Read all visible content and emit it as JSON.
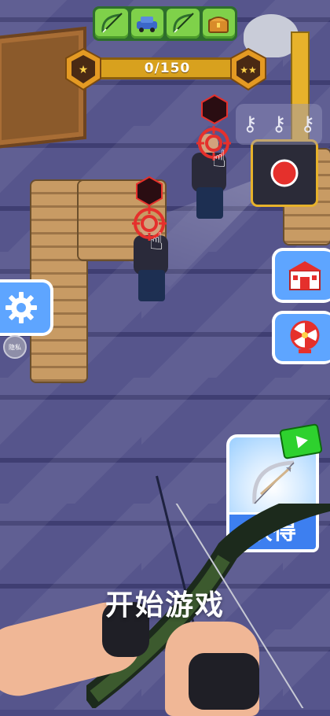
{
  "top_bar": {
    "rewards": [
      {
        "icon": "bow-icon"
      },
      {
        "icon": "car-icon"
      },
      {
        "icon": "bow-icon"
      },
      {
        "icon": "treasure-chest-icon"
      }
    ],
    "progress": {
      "text": "0/150",
      "current": 0,
      "total": 150
    },
    "badge_left": {
      "icon": "one-star-badge-icon",
      "stars": 1
    },
    "badge_right": {
      "icon": "two-star-badge-icon",
      "stars": 2
    }
  },
  "keys": {
    "icon": "key-icon",
    "count": 3
  },
  "side_buttons": {
    "settings": {
      "icon": "gear-icon"
    },
    "shop": {
      "icon": "shop-icon"
    },
    "wheel": {
      "icon": "prize-wheel-icon"
    }
  },
  "privacy": {
    "label": "隐私"
  },
  "get_card": {
    "label": "获得",
    "icon": "bow-icon",
    "badge_icon": "video-ad-icon"
  },
  "start": {
    "label": "开始游戏"
  },
  "colors": {
    "accent_blue": "#5ea5ff",
    "target_red": "#e5302c",
    "progress_gold": "#d8a11e",
    "reward_green": "#7fd14a"
  }
}
